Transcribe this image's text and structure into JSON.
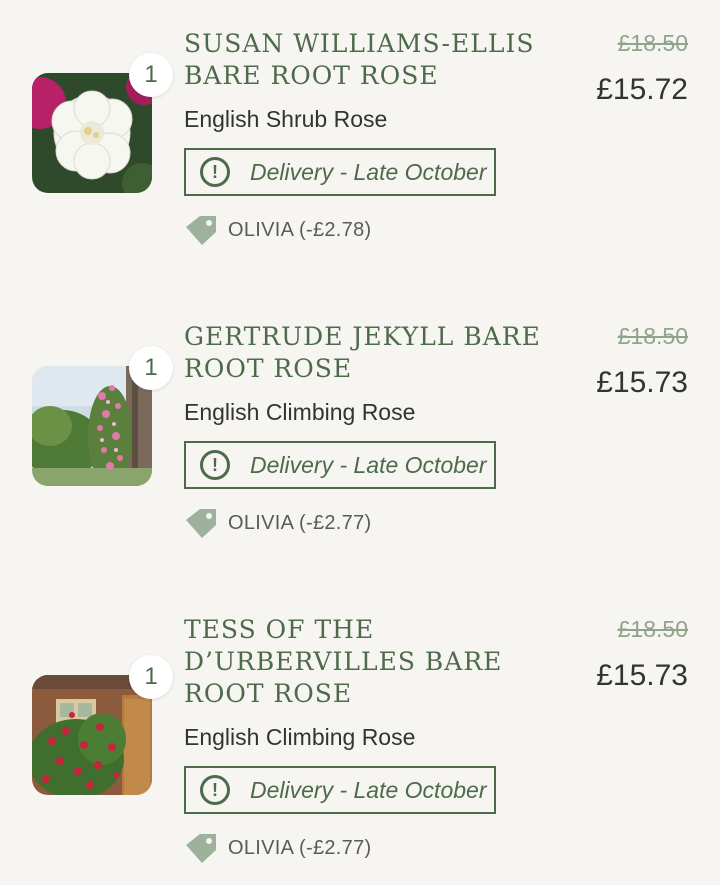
{
  "colors": {
    "accent": "#4d6b4b",
    "strikethrough_price": "#8fa58b",
    "tag": "#9cb29a",
    "background": "#f6f5f1"
  },
  "items": [
    {
      "quantity": "1",
      "title_lines": [
        "SUSAN WILLIAMS-ELLIS",
        "BARE ROOT ROSE"
      ],
      "subtitle": "English Shrub Rose",
      "delivery": "Delivery - Late October",
      "promo": "OLIVIA (-£2.78)",
      "original_price": "£18.50",
      "price": "£15.72",
      "image": "white-rose-photo"
    },
    {
      "quantity": "1",
      "title_lines": [
        "GERTRUDE JEKYLL BARE",
        "ROOT ROSE"
      ],
      "subtitle": "English Climbing Rose",
      "delivery": "Delivery - Late October",
      "promo": "OLIVIA (-£2.77)",
      "original_price": "£18.50",
      "price": "£15.73",
      "image": "pink-climbing-rose-garden-photo"
    },
    {
      "quantity": "1",
      "title_lines": [
        "TESS OF THE",
        "D’URBERVILLES BARE",
        "ROOT ROSE"
      ],
      "subtitle": "English Climbing Rose",
      "delivery": "Delivery - Late October",
      "promo": "OLIVIA (-£2.77)",
      "original_price": "£18.50",
      "price": "£15.73",
      "image": "red-climbing-rose-wall-photo"
    }
  ]
}
